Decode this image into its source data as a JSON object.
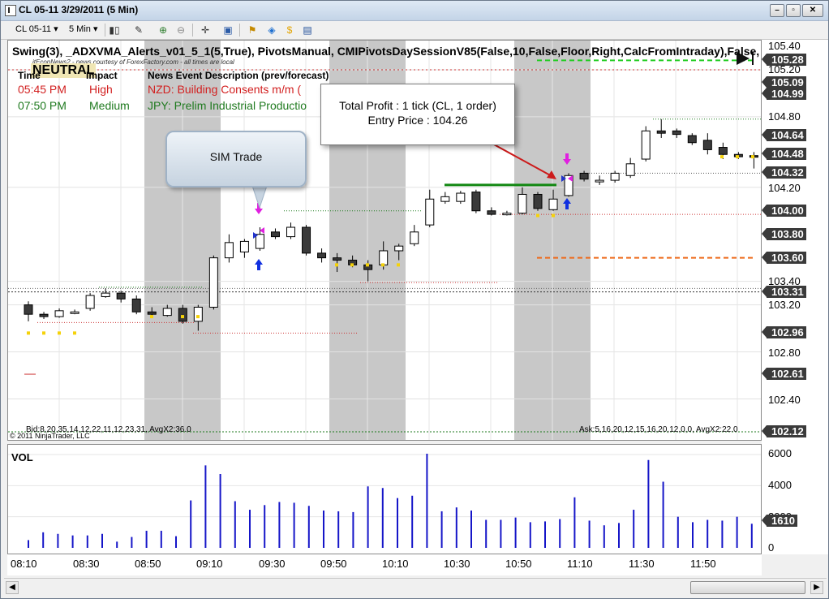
{
  "window": {
    "title": "CL 05-11  3/29/2011 (5 Min)"
  },
  "toolbar": {
    "instrument": "CL 05-11",
    "interval": "5 Min",
    "icons": [
      "candlestick-icon",
      "pencil-icon",
      "zoom-in-icon",
      "zoom-out-icon",
      "crosshair-icon",
      "properties-icon",
      "strategy-icon",
      "simulated-icon",
      "data-box-icon"
    ]
  },
  "chart": {
    "indicator_title": "Swing(3),  _ADXVMA_Alerts_v01_5_1(5,True),  PivotsManual,  CMIPivotsDaySessionV85(False,10,False,Floor,Right,CalcFromIntraday),False,",
    "neutral": "NEUTRAL",
    "credit": "jtEconNews2 - news courtesy of ForexFactory.com - all times are local",
    "news_headers": [
      "Time",
      "Impact",
      "News Event Description (prev/forecast)"
    ],
    "news_rows": [
      {
        "time": "05:45 PM",
        "impact": "High",
        "desc": "NZD: Building Consents m/m (",
        "color": "#d21f1f"
      },
      {
        "time": "07:50 PM",
        "impact": "Medium",
        "desc": "JPY: Prelim Industrial Productio",
        "color": "#1f7a1f"
      }
    ],
    "tooltip_line1": "Total Profit : 1 tick (CL, 1 order)",
    "tooltip_line2": "Entry Price : 104.26",
    "sim_label": "SIM Trade",
    "bid_text": "Bid:8,20,35,14,12,22,11,12,23,31, AvgX2:36.0",
    "ask_text": "Ask:5,16,20,12,15,16,20,12,0,0, AvgX2:22.0",
    "copyright": "© 2011 NinjaTrader, LLC",
    "vol_label": "VOL"
  },
  "price_axis": {
    "labels": [
      "105.40",
      "105.20",
      "104.80",
      "104.20",
      "103.40",
      "103.20",
      "102.80",
      "102.40"
    ],
    "tags": [
      {
        "text": "105.28",
        "value": 105.28
      },
      {
        "text": "105.09",
        "value": 105.09
      },
      {
        "text": "104.99",
        "value": 104.99
      },
      {
        "text": "104.64",
        "value": 104.64
      },
      {
        "text": "104.48",
        "value": 104.48
      },
      {
        "text": "104.32",
        "value": 104.32
      },
      {
        "text": "104.00",
        "value": 104.0
      },
      {
        "text": "103.80",
        "value": 103.8
      },
      {
        "text": "103.60",
        "value": 103.6
      },
      {
        "text": "103.31",
        "value": 103.31
      },
      {
        "text": "102.96",
        "value": 102.96
      },
      {
        "text": "102.61",
        "value": 102.61
      },
      {
        "text": "102.12",
        "value": 102.12
      }
    ]
  },
  "vol_axis": {
    "labels": [
      "6000",
      "4000",
      "2000",
      "0"
    ],
    "tag": "1610"
  },
  "time_axis": [
    "08:10",
    "08:30",
    "08:50",
    "09:10",
    "09:30",
    "09:50",
    "10:10",
    "10:30",
    "10:50",
    "11:10",
    "11:30",
    "11:50"
  ],
  "chart_data": {
    "type": "candlestick",
    "candles": [
      {
        "o": 103.2,
        "h": 103.23,
        "l": 103.06,
        "c": 103.12
      },
      {
        "o": 103.12,
        "h": 103.14,
        "l": 103.08,
        "c": 103.1
      },
      {
        "o": 103.1,
        "h": 103.17,
        "l": 103.09,
        "c": 103.15
      },
      {
        "o": 103.14,
        "h": 103.16,
        "l": 103.12,
        "c": 103.14
      },
      {
        "o": 103.17,
        "h": 103.3,
        "l": 103.15,
        "c": 103.28
      },
      {
        "o": 103.27,
        "h": 103.34,
        "l": 103.26,
        "c": 103.3
      },
      {
        "o": 103.3,
        "h": 103.32,
        "l": 103.22,
        "c": 103.25
      },
      {
        "o": 103.25,
        "h": 103.28,
        "l": 103.12,
        "c": 103.14
      },
      {
        "o": 103.14,
        "h": 103.18,
        "l": 103.1,
        "c": 103.12
      },
      {
        "o": 103.11,
        "h": 103.2,
        "l": 103.1,
        "c": 103.17
      },
      {
        "o": 103.17,
        "h": 103.2,
        "l": 103.04,
        "c": 103.06
      },
      {
        "o": 103.06,
        "h": 103.2,
        "l": 102.98,
        "c": 103.18
      },
      {
        "o": 103.18,
        "h": 103.62,
        "l": 103.16,
        "c": 103.6
      },
      {
        "o": 103.6,
        "h": 103.8,
        "l": 103.56,
        "c": 103.73
      },
      {
        "o": 103.65,
        "h": 103.76,
        "l": 103.6,
        "c": 103.74
      },
      {
        "o": 103.68,
        "h": 103.86,
        "l": 103.66,
        "c": 103.8
      },
      {
        "o": 103.82,
        "h": 103.85,
        "l": 103.76,
        "c": 103.78
      },
      {
        "o": 103.78,
        "h": 103.9,
        "l": 103.76,
        "c": 103.86
      },
      {
        "o": 103.86,
        "h": 103.88,
        "l": 103.62,
        "c": 103.64
      },
      {
        "o": 103.64,
        "h": 103.68,
        "l": 103.56,
        "c": 103.6
      },
      {
        "o": 103.6,
        "h": 103.64,
        "l": 103.48,
        "c": 103.58
      },
      {
        "o": 103.58,
        "h": 103.62,
        "l": 103.52,
        "c": 103.54
      },
      {
        "o": 103.54,
        "h": 103.58,
        "l": 103.4,
        "c": 103.5
      },
      {
        "o": 103.54,
        "h": 103.74,
        "l": 103.5,
        "c": 103.66
      },
      {
        "o": 103.66,
        "h": 103.72,
        "l": 103.58,
        "c": 103.7
      },
      {
        "o": 103.72,
        "h": 103.88,
        "l": 103.7,
        "c": 103.82
      },
      {
        "o": 103.88,
        "h": 104.18,
        "l": 103.86,
        "c": 104.1
      },
      {
        "o": 104.08,
        "h": 104.16,
        "l": 104.06,
        "c": 104.12
      },
      {
        "o": 104.08,
        "h": 104.17,
        "l": 104.06,
        "c": 104.15
      },
      {
        "o": 104.16,
        "h": 104.18,
        "l": 103.98,
        "c": 104.0
      },
      {
        "o": 104.0,
        "h": 104.03,
        "l": 103.96,
        "c": 103.97
      },
      {
        "o": 103.97,
        "h": 104.0,
        "l": 103.96,
        "c": 103.98
      },
      {
        "o": 103.98,
        "h": 104.2,
        "l": 103.97,
        "c": 104.14
      },
      {
        "o": 104.14,
        "h": 104.16,
        "l": 104.0,
        "c": 104.02
      },
      {
        "o": 104.01,
        "h": 104.18,
        "l": 104.0,
        "c": 104.1
      },
      {
        "o": 104.13,
        "h": 104.32,
        "l": 104.12,
        "c": 104.3
      },
      {
        "o": 104.32,
        "h": 104.34,
        "l": 104.25,
        "c": 104.27
      },
      {
        "o": 104.26,
        "h": 104.3,
        "l": 104.22,
        "c": 104.26
      },
      {
        "o": 104.26,
        "h": 104.34,
        "l": 104.24,
        "c": 104.32
      },
      {
        "o": 104.3,
        "h": 104.45,
        "l": 104.28,
        "c": 104.4
      },
      {
        "o": 104.44,
        "h": 104.72,
        "l": 104.42,
        "c": 104.68
      },
      {
        "o": 104.68,
        "h": 104.78,
        "l": 104.62,
        "c": 104.66
      },
      {
        "o": 104.68,
        "h": 104.7,
        "l": 104.62,
        "c": 104.65
      },
      {
        "o": 104.64,
        "h": 104.66,
        "l": 104.56,
        "c": 104.58
      },
      {
        "o": 104.6,
        "h": 104.66,
        "l": 104.48,
        "c": 104.52
      },
      {
        "o": 104.54,
        "h": 104.58,
        "l": 104.44,
        "c": 104.48
      },
      {
        "o": 104.48,
        "h": 104.5,
        "l": 104.44,
        "c": 104.46
      },
      {
        "o": 104.47,
        "h": 104.5,
        "l": 104.36,
        "c": 104.46
      }
    ],
    "volume": [
      500,
      1000,
      900,
      800,
      800,
      900,
      400,
      700,
      1100,
      1100,
      750,
      3050,
      5300,
      4750,
      3000,
      2450,
      2750,
      2950,
      2900,
      2700,
      2400,
      2350,
      2300,
      3950,
      3850,
      3200,
      3350,
      6050,
      2350,
      2600,
      2400,
      1800,
      1800,
      1950,
      1650,
      1700,
      1850,
      3250,
      1750,
      1450,
      1600,
      2450,
      5650,
      4250,
      2000,
      1650,
      1800,
      1750,
      2000,
      1550,
      1550
    ],
    "ylim": [
      102.12,
      105.4
    ],
    "vol_ylim": [
      0,
      6000
    ]
  }
}
